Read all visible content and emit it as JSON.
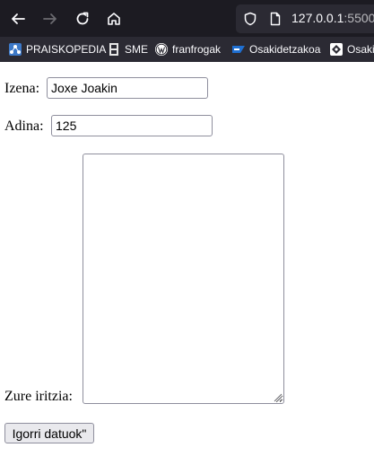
{
  "browser": {
    "url_host": "127.0.0.1",
    "url_port": ":5500",
    "icons": {
      "back": "arrow-left-icon",
      "forward": "arrow-right-icon",
      "reload": "reload-icon",
      "home": "home-icon",
      "tracking": "shield-icon",
      "page": "page-icon"
    },
    "bookmarks": [
      {
        "label": "PRAISKOPEDIA",
        "icon": "network-icon"
      },
      {
        "label": "SME",
        "icon": "film-icon"
      },
      {
        "label": "franfrogak",
        "icon": "wordpress-icon"
      },
      {
        "label": "Osakidetzakoa",
        "icon": "sap-icon"
      },
      {
        "label": "Osaki",
        "icon": "puzzle-icon"
      }
    ]
  },
  "form": {
    "name_label": "Izena:",
    "name_value": "Joxe Joakin",
    "age_label": "Adina:",
    "age_value": "125",
    "opinion_label": "Zure iritzia:",
    "opinion_value": "",
    "submit_label": "Igorri datuok\""
  },
  "colors": {
    "toolbar_bg": "#1c1b22",
    "bookmarks_bg": "#2b2a33",
    "button_bg": "#e9e9ed",
    "input_border": "#8f8f9d"
  }
}
